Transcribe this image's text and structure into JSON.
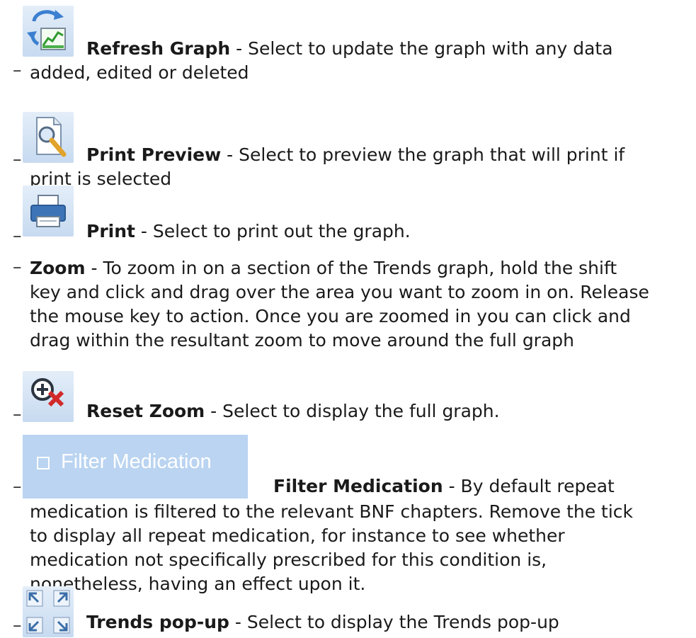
{
  "dash": "–",
  "items": [
    {
      "icon": "refresh-graph-icon",
      "title": "Refresh Graph",
      "desc": " - Select to update the graph with any data",
      "cont": [
        "added, edited or deleted"
      ]
    },
    {
      "icon": "print-preview-icon",
      "title": "Print Preview",
      "desc": " - Select to preview the graph that will print if",
      "cont": [
        "print is selected"
      ]
    },
    {
      "icon": "printer-icon",
      "title": "Print",
      "desc": " - Select to print out the graph.",
      "cont": []
    },
    {
      "icon": "",
      "title": "Zoom",
      "desc": " - To zoom in on a section of the Trends graph, hold the shift",
      "cont": [
        "key and click and drag over the area you want to zoom in on. Release",
        "the mouse key to action. Once you are zoomed in you can click and",
        "drag within the resultant zoom to move around the full graph"
      ]
    },
    {
      "icon": "reset-zoom-icon",
      "title": "Reset Zoom",
      "desc": " - Select to display the full graph.",
      "cont": []
    },
    {
      "icon": "filter-medication-checkbox",
      "filter_label": "Filter Medication",
      "title": "Filter Medication",
      "desc": " - By default repeat",
      "cont": [
        "medication is filtered to the relevant BNF chapters. Remove the tick",
        "to display all repeat medication, for instance to see whether",
        "medication not specifically prescribed for this condition is,",
        "nonetheless, having an effect upon it."
      ]
    },
    {
      "icon": "expand-arrows-icon",
      "title": "Trends pop-up",
      "desc": " - Select to display the Trends pop-up",
      "cont": []
    }
  ],
  "colors": {
    "icon_bg": "#c7daf0",
    "filter_bg": "#bad4f1",
    "text": "#1a1a1a"
  }
}
